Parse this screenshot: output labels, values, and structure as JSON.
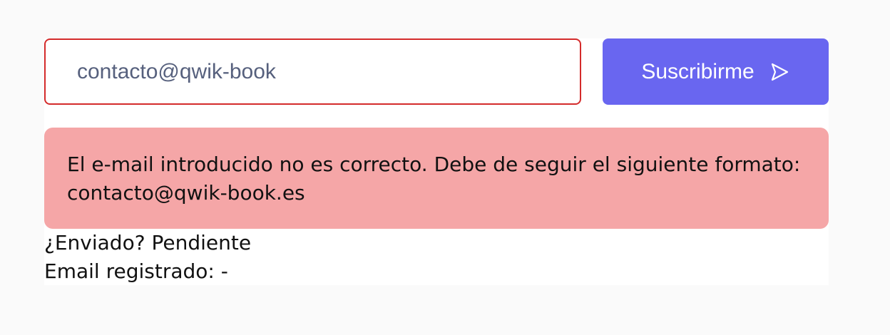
{
  "form": {
    "email_value": "contacto@qwik-book",
    "subscribe_label": "Suscribirme",
    "subscribe_icon": "send-icon",
    "error_message": "El e-mail introducido no es correcto. Debe de seguir el siguiente formato: contacto@qwik-book.es"
  },
  "status": {
    "sent_label": "¿Enviado?",
    "sent_value": "Pendiente",
    "email_label": "Email registrado:",
    "email_value": "-"
  },
  "colors": {
    "page_background": "#fafafa",
    "input_error_border": "#d42b2b",
    "input_text": "#56607d",
    "button_background": "#6966f0",
    "button_text": "#ffffff",
    "error_background": "#f5a6a7"
  }
}
